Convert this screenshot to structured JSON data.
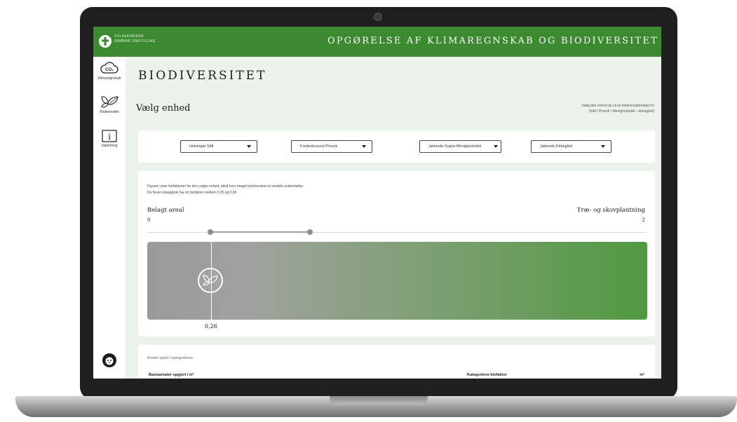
{
  "header": {
    "org_line1": "FOLKEKIRKENS",
    "org_line2": "GRØNNE OMSTILLING",
    "title": "OPGØRELSE AF KLIMAREGNSKAB OG BIODIVERSITET"
  },
  "sidebar": {
    "items": [
      {
        "label": "Klimaregnskab",
        "icon": "co2-cloud-icon"
      },
      {
        "label": "Biodiversitet",
        "icon": "butterfly-leaf-icon"
      },
      {
        "label": "Vejledning",
        "icon": "info-icon"
      }
    ],
    "bottom_icon": "accessibility-icon"
  },
  "page": {
    "title": "BIODIVERSITET",
    "section_title": "Vælg enhed",
    "hint_line1": "Vælg den enhed du vil se biodiversitetsdata for",
    "hint_line2": "(Stift / Provsti / Menighedsråd – kirkegård)"
  },
  "selects": {
    "stift": "Helsingør Stift",
    "provsti": "Frederikssund Provsti",
    "menighedsraad": "Jørlunde Sogns Menighedsråd",
    "kirkegaard": "Jørlunde Kirkegård"
  },
  "figure": {
    "description_line1": "Figuren viser biofaktoren for den valgte enhed, altså hvor meget biodiversitet et område understøtter.",
    "description_line2": "De fleste kirkegårde har en biofaktor mellem 0,25 og 0,65.",
    "label_left": "Belagt areal",
    "label_right": "Træ- og skovplantning",
    "value_left": "0",
    "value_right": "2",
    "marker_value": "0,26",
    "marker_value_num": 0.26,
    "range_low": 0.25,
    "range_high": 0.65,
    "colors": {
      "gradient_start": "#9a9a9a",
      "gradient_end": "#509940",
      "brand": "#3b8a2f"
    }
  },
  "table": {
    "caption": "Arealer oplyst i spørgeskema",
    "col1": "Basisarealer opgjort i m²",
    "col2": "Kategoriens biofaktor",
    "col3": "m²"
  }
}
